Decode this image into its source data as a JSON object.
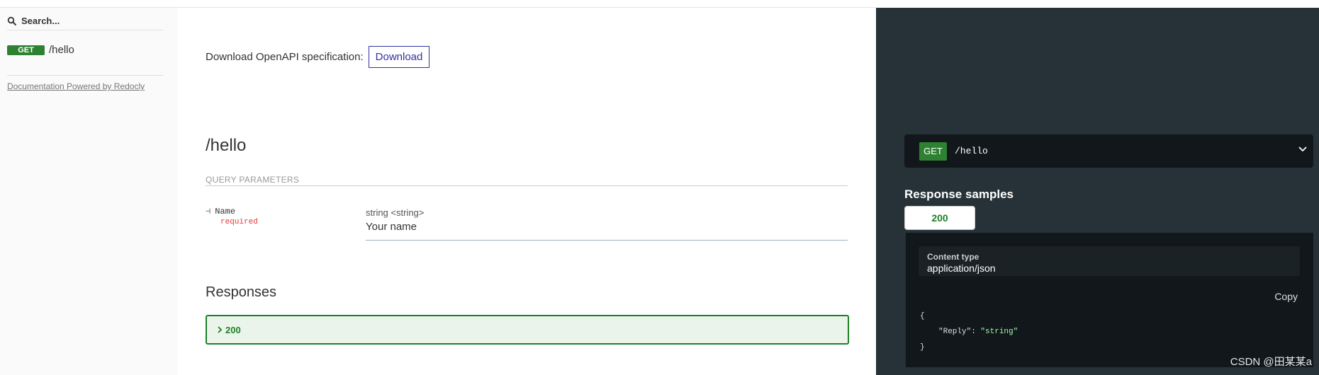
{
  "sidebar": {
    "search_placeholder": "Search...",
    "operations": [
      {
        "method": "GET",
        "path": "/hello"
      }
    ],
    "powered_by": "Documentation Powered by Redocly"
  },
  "main": {
    "download_label": "Download OpenAPI specification:",
    "download_button": "Download",
    "operation_title": "/hello",
    "query_params_header": "QUERY PARAMETERS",
    "params": [
      {
        "arrow": "⊣",
        "name": "Name",
        "required": "required",
        "type": "string <string>",
        "description": "Your name"
      }
    ],
    "responses_title": "Responses",
    "responses": [
      {
        "code": "200"
      }
    ]
  },
  "right": {
    "method": "GET",
    "path": "/hello",
    "response_samples_title": "Response samples",
    "active_tab": "200",
    "content_type_label": "Content type",
    "content_type_value": "application/json",
    "copy_label": "Copy",
    "code": {
      "open": "{",
      "key": "\"Reply\"",
      "colon": ": ",
      "value": "\"string\"",
      "close": "}"
    }
  },
  "watermark": "CSDN @田某某a",
  "colors": {
    "get_green": "#2f8132",
    "response_green": "#1d8127",
    "link_blue": "#32329f",
    "required_red": "#e53935",
    "right_panel_bg": "#263238",
    "code_bg": "#11171a"
  },
  "icons": [
    "search-icon",
    "param-arrow-icon",
    "chevron-right-icon",
    "chevron-down-icon"
  ]
}
